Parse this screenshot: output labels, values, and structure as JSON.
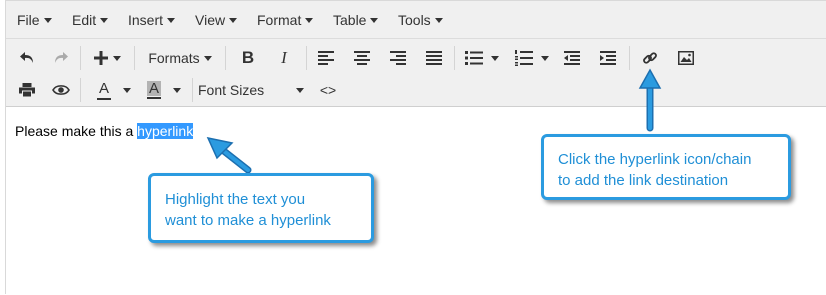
{
  "menubar": {
    "items": [
      {
        "label": "File"
      },
      {
        "label": "Edit"
      },
      {
        "label": "Insert"
      },
      {
        "label": "View"
      },
      {
        "label": "Format"
      },
      {
        "label": "Table"
      },
      {
        "label": "Tools"
      }
    ]
  },
  "toolbar": {
    "formats_label": "Formats",
    "bold_label": "B",
    "italic_label": "I",
    "font_sizes_label": "Font Sizes",
    "code_label": "<>",
    "font_color_letter": "A",
    "bg_color_letter": "A",
    "icons": [
      "undo-icon",
      "redo-icon",
      "insert-plus-icon",
      "align-left-icon",
      "align-center-icon",
      "align-right-icon",
      "align-justify-icon",
      "bullet-list-icon",
      "numbered-list-icon",
      "outdent-icon",
      "indent-icon",
      "link-chain-icon",
      "image-icon",
      "print-icon",
      "preview-eye-icon"
    ],
    "colors": {
      "accent": "#2b9be0",
      "selection": "#3399ff"
    }
  },
  "content": {
    "text_before": "Please make this a ",
    "selected_text": "hyperlink"
  },
  "callouts": {
    "highlight": {
      "line1": "Highlight the text you",
      "line2": "want to make a hyperlink"
    },
    "link": {
      "line1": "Click the hyperlink icon/chain",
      "line2": "to add the link destination"
    }
  }
}
